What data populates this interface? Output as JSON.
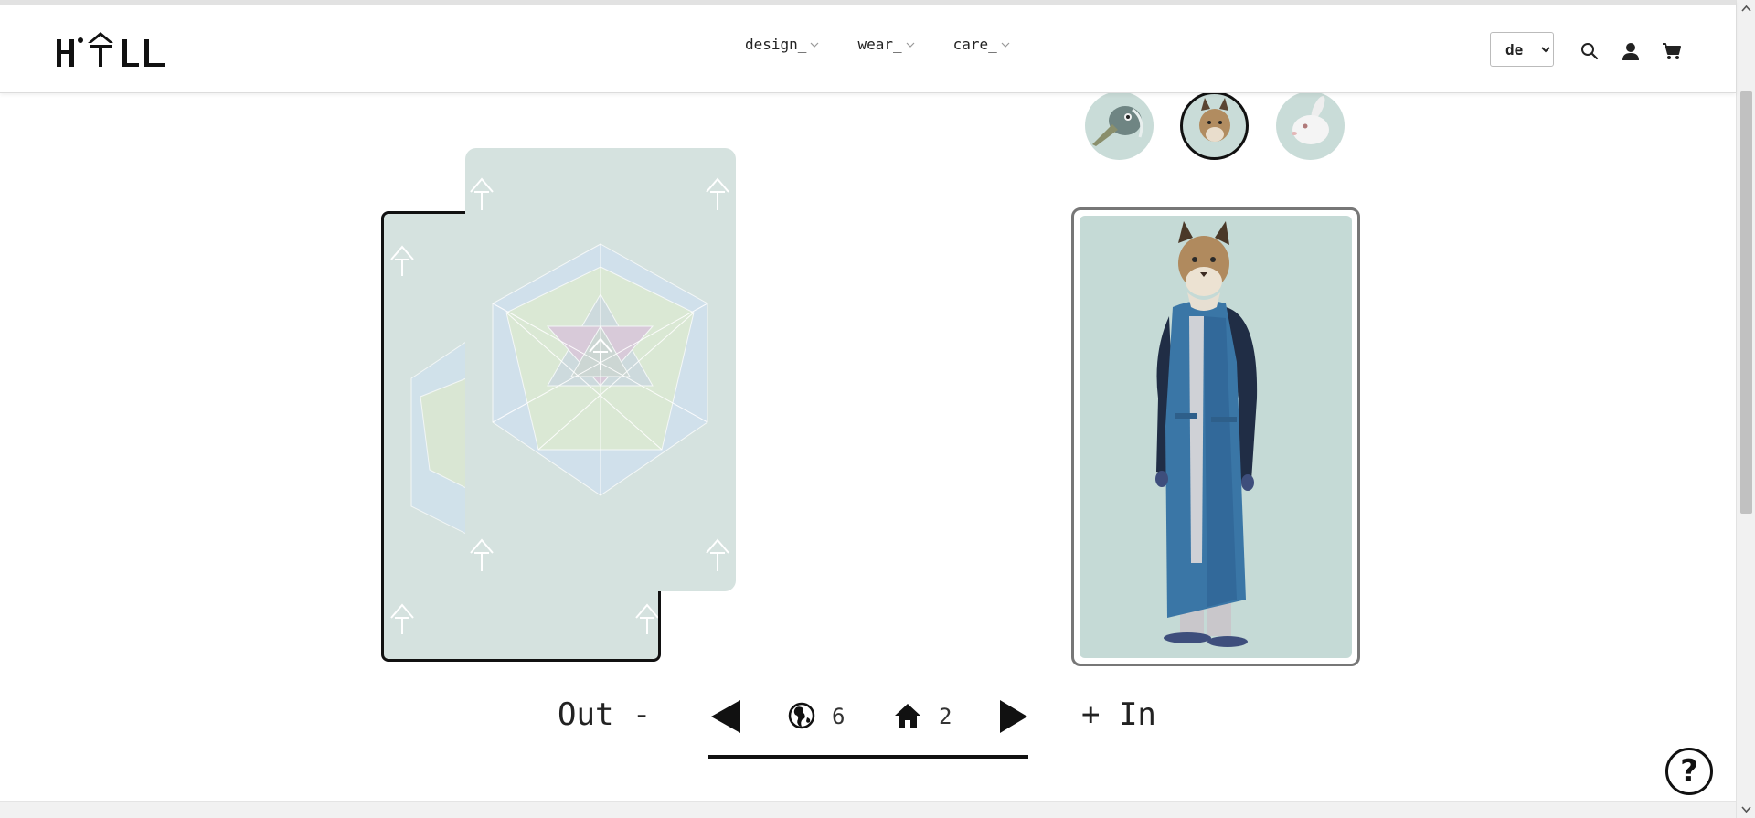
{
  "header": {
    "logo_text": "HALL",
    "nav": [
      {
        "label": "design_"
      },
      {
        "label": "wear_"
      },
      {
        "label": "care_"
      }
    ],
    "language": {
      "selected": "de"
    }
  },
  "icons": {
    "search": "search-icon",
    "account": "user-icon",
    "cart": "cart-icon",
    "globe": "globe-icon",
    "home": "home-icon"
  },
  "thumbs": [
    {
      "name": "bird"
    },
    {
      "name": "lynx",
      "selected": true
    },
    {
      "name": "rabbit"
    }
  ],
  "controls": {
    "out_label": "Out -",
    "in_label": "+ In",
    "globe_count": "6",
    "home_count": "2"
  },
  "help_label": "?",
  "colors": {
    "card_bg": "#d5e2df",
    "preview_bg": "#c5dad6",
    "coat": "#3a76a6"
  }
}
